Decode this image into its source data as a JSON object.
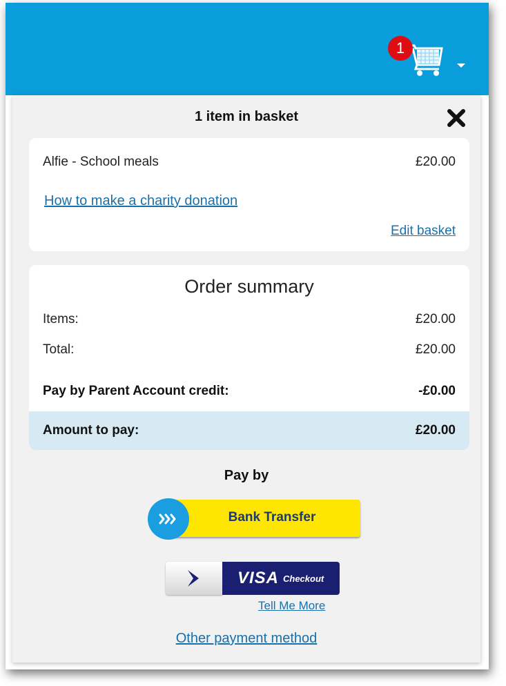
{
  "header": {
    "cart_badge_count": "1",
    "cart_icon": "shopping-cart-icon",
    "dropdown_icon": "caret-down-icon",
    "bar_color": "#0a9ddc",
    "badge_color": "#e00c13"
  },
  "basket": {
    "title": "1 item in basket",
    "close_icon": "close-x-icon",
    "items": [
      {
        "name": "Alfie - School meals",
        "price": "£20.00"
      }
    ],
    "charity_link": "How to make a charity donation",
    "edit_link": "Edit basket"
  },
  "summary": {
    "title": "Order summary",
    "items_label": "Items:",
    "items_value": "£20.00",
    "total_label": "Total:",
    "total_value": "£20.00",
    "credit_label": "Pay by Parent Account credit:",
    "credit_value": "-£0.00",
    "amount_label": "Amount to pay:",
    "amount_value": "£20.00"
  },
  "payment": {
    "pay_by_label": "Pay by",
    "bank_transfer_label": "Bank Transfer",
    "bank_icon": "chevrons-right-icon",
    "visa_label": "VISA",
    "visa_sub_label": "Checkout",
    "visa_icon": "chevron-right-icon",
    "tell_me_more": "Tell Me More",
    "other_method": "Other payment method"
  }
}
